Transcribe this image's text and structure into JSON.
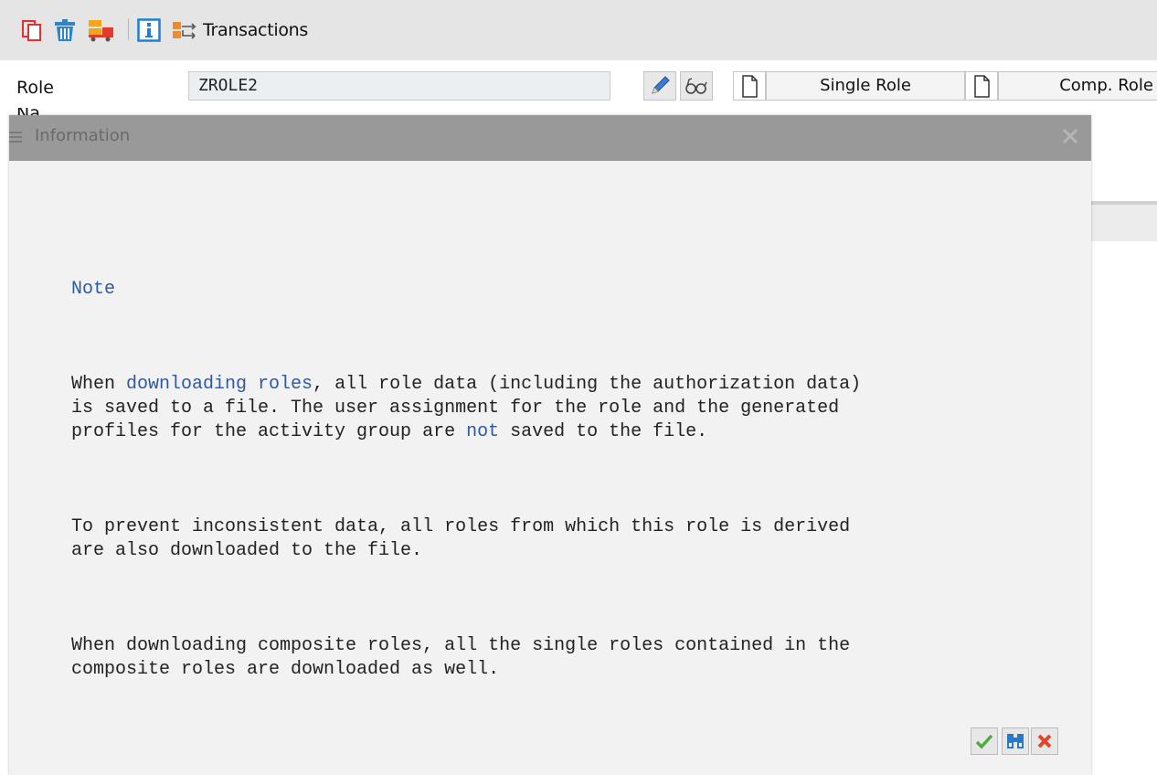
{
  "toolbar": {
    "icons": [
      "copy-icon",
      "delete-icon",
      "transport-icon",
      "info-icon",
      "transactions-icon"
    ],
    "transactions_label": "Transactions"
  },
  "header": {
    "role_label": "Role",
    "role_value": "ZROLE2",
    "name_label": "Na",
    "single_role_label": "Single Role",
    "comp_role_label": "Comp. Role"
  },
  "dialog": {
    "title": "Information",
    "note_heading": "Note",
    "p1_before": "When ",
    "p1_link": "downloading roles",
    "p1_after1": ", all role data (including the authorization data)\nis saved to a file. The user assignment for the role and the generated\nprofiles for the activity group are ",
    "p1_link2": "not",
    "p1_after2": " saved to the file.",
    "p2": "To prevent inconsistent data, all roles from which this role is derived\nare also downloaded to the file.",
    "p3": "When downloading composite roles, all the single roles contained in the\ncomposite roles are downloaded as well.",
    "buttons": [
      "continue-button",
      "find-button",
      "cancel-button"
    ]
  },
  "colors": {
    "link": "#2f5a9e",
    "title_bar": "#999999",
    "dialog_bg": "#f2f2f2",
    "toolbar_bg": "#e5e5e5"
  }
}
